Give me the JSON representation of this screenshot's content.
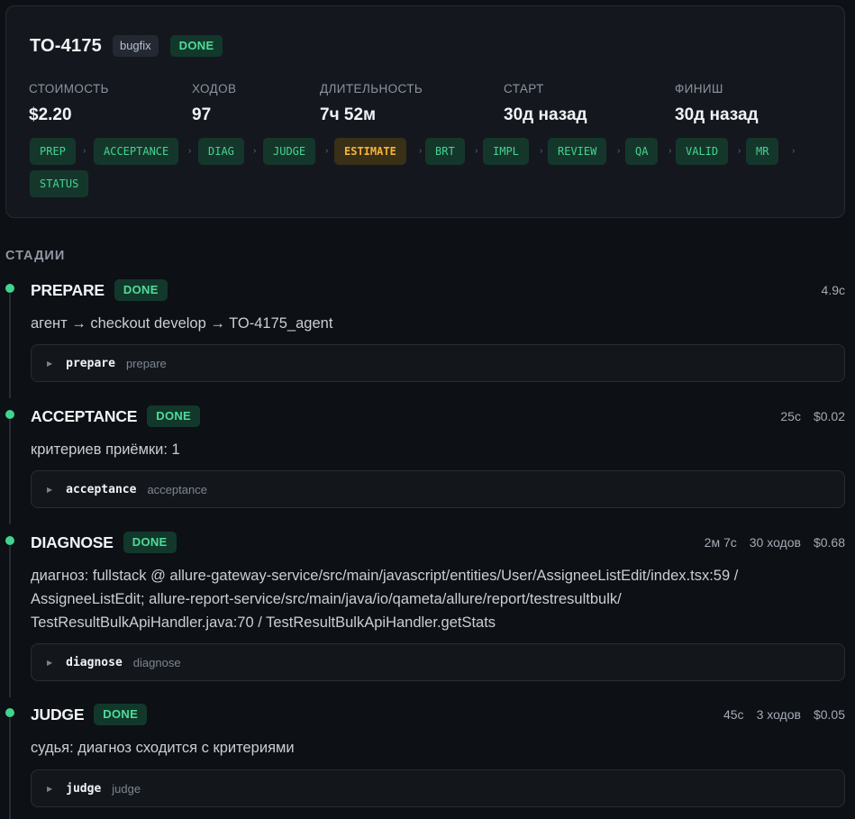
{
  "task": {
    "id": "TO-4175",
    "type_tag": "bugfix",
    "status": "DONE"
  },
  "stats": [
    {
      "label": "СТОИМОСТЬ",
      "value": "$2.20"
    },
    {
      "label": "ХОДОВ",
      "value": "97"
    },
    {
      "label": "ДЛИТЕЛЬНОСТЬ",
      "value": "7ч 52м"
    },
    {
      "label": "СТАРТ",
      "value": "30д назад"
    },
    {
      "label": "ФИНИШ",
      "value": "30д назад"
    }
  ],
  "pipeline": {
    "separator": "›",
    "steps": [
      "PREP",
      "ACCEPTANCE",
      "DIAG",
      "JUDGE",
      "ESTIMATE",
      "BRT",
      "IMPL",
      "REVIEW",
      "QA",
      "VALID",
      "MR",
      "STATUS"
    ],
    "active_step": "ESTIMATE"
  },
  "stages_title": "СТАДИИ",
  "stages": [
    {
      "name": "PREPARE",
      "status": "DONE",
      "meta": [
        "4.9с"
      ],
      "desc": "агент → checkout develop → TO-4175_agent",
      "sub": {
        "name": "prepare",
        "hint": "prepare"
      }
    },
    {
      "name": "ACCEPTANCE",
      "status": "DONE",
      "meta": [
        "25с",
        "$0.02"
      ],
      "desc": "критериев приёмки: 1",
      "sub": {
        "name": "acceptance",
        "hint": "acceptance"
      }
    },
    {
      "name": "DIAGNOSE",
      "status": "DONE",
      "meta": [
        "2м 7с",
        "30 ходов",
        "$0.68"
      ],
      "desc_lines": [
        "диагноз: fullstack @ allure-gateway-service/src/main/javascript/entities/User/AssigneeListEdit/index.tsx:59 /",
        "AssigneeListEdit; allure-report-service/src/main/java/io/qameta/allure/report/testresultbulk/",
        "TestResultBulkApiHandler.java:70 / TestResultBulkApiHandler.getStats"
      ],
      "sub": {
        "name": "diagnose",
        "hint": "diagnose"
      }
    },
    {
      "name": "JUDGE",
      "status": "DONE",
      "meta": [
        "45с",
        "3 ходов",
        "$0.05"
      ],
      "desc": "судья: диагноз сходится с критериями",
      "sub": {
        "name": "judge",
        "hint": "judge"
      }
    }
  ],
  "icons": {
    "expand": "triangle-right-icon",
    "stage_marker": "dot-icon"
  },
  "colors": {
    "done_green": "#44d492",
    "estimate_amber": "#f4b43c"
  }
}
